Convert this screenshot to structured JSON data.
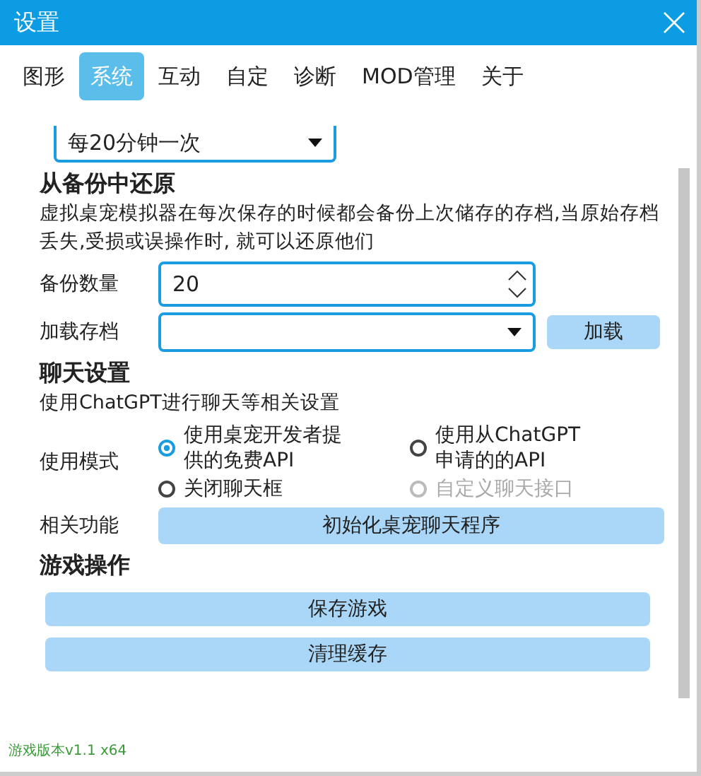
{
  "window": {
    "title": "设置"
  },
  "tabs": [
    {
      "label": "图形",
      "selected": false
    },
    {
      "label": "系统",
      "selected": true
    },
    {
      "label": "互动",
      "selected": false
    },
    {
      "label": "自定",
      "selected": false
    },
    {
      "label": "诊断",
      "selected": false
    },
    {
      "label": "MOD管理",
      "selected": false
    },
    {
      "label": "关于",
      "selected": false
    }
  ],
  "autosave": {
    "value": "每20分钟一次"
  },
  "restore": {
    "heading": "从备份中还原",
    "description": "虚拟桌宠模拟器在每次保存的时候都会备份上次储存的存档,当原始存档丢失,受损或误操作时, 就可以还原他们",
    "backup_count": {
      "label": "备份数量",
      "value": "20"
    },
    "load_save": {
      "label": "加载存档",
      "button": "加载"
    }
  },
  "chat": {
    "heading": "聊天设置",
    "description": "使用ChatGPT进行聊天等相关设置",
    "mode_label": "使用模式",
    "modes": [
      {
        "label": "使用桌宠开发者提供的免费API",
        "selected": true,
        "disabled": false
      },
      {
        "label": "使用从ChatGPT申请的的API",
        "selected": false,
        "disabled": false
      },
      {
        "label": "关闭聊天框",
        "selected": false,
        "disabled": false
      },
      {
        "label": "自定义聊天接口",
        "selected": false,
        "disabled": true
      }
    ],
    "function_label": "相关功能",
    "function_button": "初始化桌宠聊天程序"
  },
  "game": {
    "heading": "游戏操作",
    "buttons": [
      "保存游戏",
      "清理缓存"
    ]
  },
  "footer": "游戏版本v1.1 x64"
}
